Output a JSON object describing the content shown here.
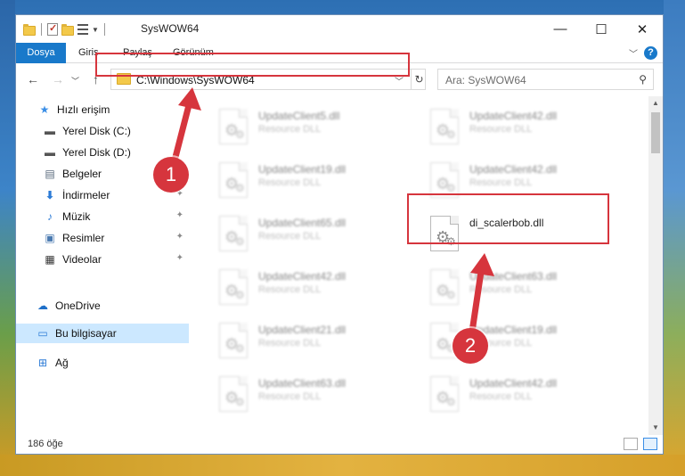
{
  "window": {
    "title": "SysWOW64",
    "controls": {
      "minimize": "—",
      "maximize": "☐",
      "close": "✕"
    }
  },
  "ribbon": {
    "tabs": [
      "Dosya",
      "Giriş",
      "Paylaş",
      "Görünüm"
    ],
    "help": "?"
  },
  "navigation": {
    "address": "C:\\Windows\\SysWOW64",
    "search_placeholder": "Ara: SysWOW64"
  },
  "sidebar": {
    "quick_access": "Hızlı erişim",
    "items": [
      {
        "label": "Yerel Disk (C:)",
        "icon": "drive-icon"
      },
      {
        "label": "Yerel Disk (D:)",
        "icon": "drive-icon"
      },
      {
        "label": "Belgeler",
        "icon": "documents-icon"
      },
      {
        "label": "İndirmeler",
        "icon": "downloads-icon"
      },
      {
        "label": "Müzik",
        "icon": "music-icon"
      },
      {
        "label": "Resimler",
        "icon": "pictures-icon"
      },
      {
        "label": "Videolar",
        "icon": "videos-icon"
      }
    ],
    "onedrive": "OneDrive",
    "this_pc": "Bu bilgisayar",
    "network": "Ağ"
  },
  "files": [
    {
      "name": "UpdateClient5.dll",
      "desc": "Resource DLL"
    },
    {
      "name": "UpdateClient42.dll",
      "desc": "Resource DLL"
    },
    {
      "name": "UpdateClient19.dll",
      "desc": "Resource DLL"
    },
    {
      "name": "UpdateClient42.dll",
      "desc": "Resource DLL"
    },
    {
      "name": "UpdateClient65.dll",
      "desc": "Resource DLL"
    },
    {
      "name": "di_scalerbob.dll",
      "desc": ""
    },
    {
      "name": "UpdateClient42.dll",
      "desc": "Resource DLL"
    },
    {
      "name": "UpdateClient63.dll",
      "desc": "Resource DLL"
    },
    {
      "name": "UpdateClient21.dll",
      "desc": "Resource DLL"
    },
    {
      "name": "UpdateClient19.dll",
      "desc": "Resource DLL"
    },
    {
      "name": "UpdateClient63.dll",
      "desc": "Resource DLL"
    },
    {
      "name": "UpdateClient42.dll",
      "desc": "Resource DLL"
    }
  ],
  "status": {
    "count": "186 öğe"
  },
  "annotations": {
    "step1": "1",
    "step2": "2"
  },
  "colors": {
    "accent": "#1979ca",
    "highlight": "#d6353d",
    "selected": "#cce8ff"
  }
}
